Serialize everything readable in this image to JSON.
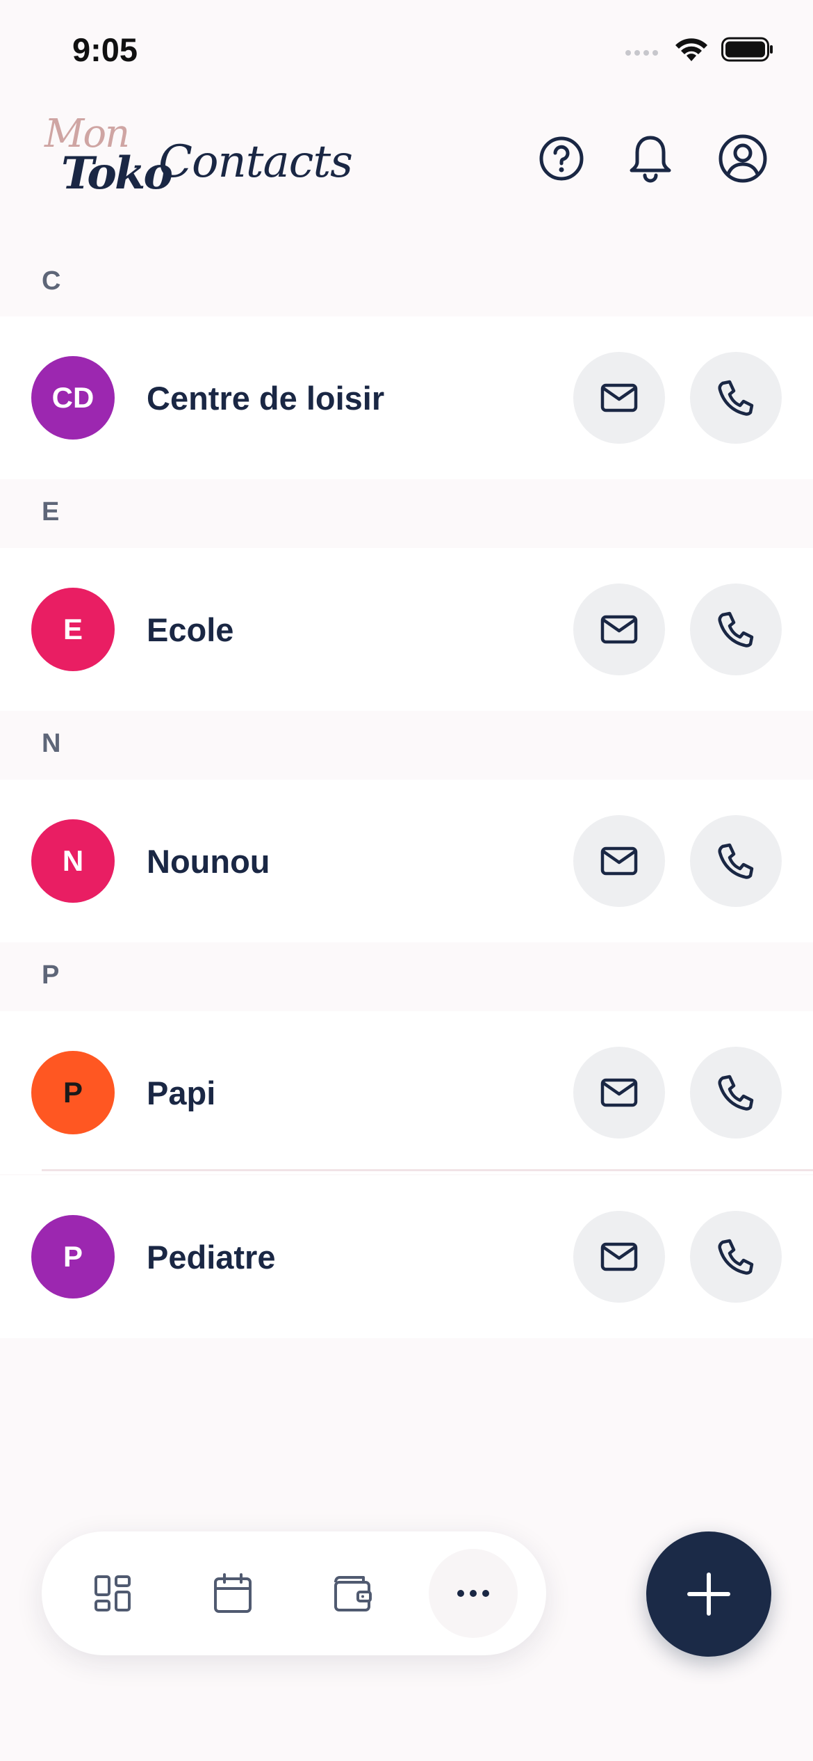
{
  "status_bar": {
    "time": "9:05"
  },
  "header": {
    "logo_word_1": "Mon",
    "logo_word_2": "Toko",
    "title": "Contacts",
    "icons": [
      "help-icon",
      "bell-icon",
      "account-icon"
    ]
  },
  "sections": [
    {
      "letter": "C",
      "contacts": [
        {
          "initials": "CD",
          "name": "Centre de loisir",
          "color": "#9c27b0"
        }
      ]
    },
    {
      "letter": "E",
      "contacts": [
        {
          "initials": "E",
          "name": "Ecole",
          "color": "#e91e63"
        }
      ]
    },
    {
      "letter": "N",
      "contacts": [
        {
          "initials": "N",
          "name": "Nounou",
          "color": "#e91e63"
        }
      ]
    },
    {
      "letter": "P",
      "contacts": [
        {
          "initials": "P",
          "name": "Papi",
          "color": "#ff5722"
        },
        {
          "initials": "P",
          "name": "Pediatre",
          "color": "#9c27b0"
        }
      ]
    }
  ],
  "row_actions": [
    "mail-icon",
    "phone-icon"
  ],
  "bottom_nav": {
    "items": [
      "dashboard-icon",
      "calendar-icon",
      "wallet-icon",
      "more-icon"
    ],
    "active": "more-icon"
  },
  "fab": {
    "icon": "plus-icon"
  },
  "colors": {
    "primary": "#1a2744",
    "logo_accent": "#cfa5a3",
    "background": "#fcf9fa",
    "button_bg": "#eeeff1"
  }
}
